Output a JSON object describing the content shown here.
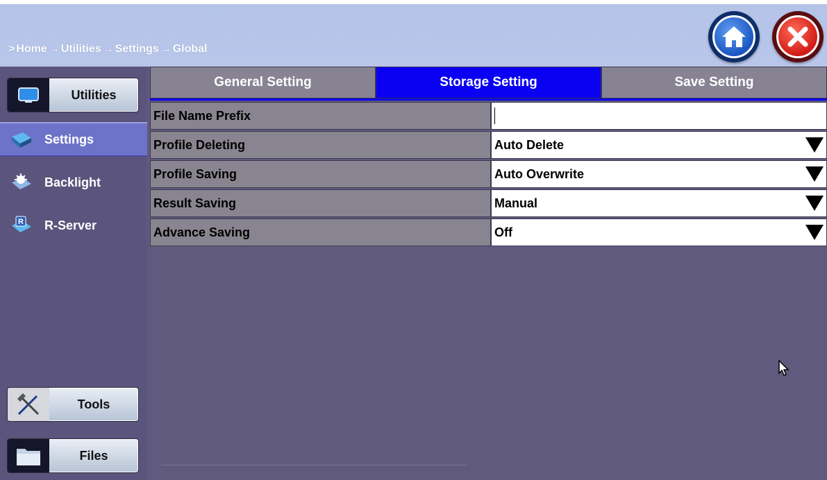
{
  "breadcrumb": [
    "Home",
    "Utilities",
    "Settings",
    "Global"
  ],
  "header": {
    "home_icon": "home-icon",
    "close_icon": "close-icon"
  },
  "sidebar": {
    "top_button": {
      "label": "Utilities",
      "icon": "monitor-icon"
    },
    "items": [
      {
        "label": "Settings",
        "icon": "settings-icon",
        "active": true
      },
      {
        "label": "Backlight",
        "icon": "backlight-icon",
        "active": false
      },
      {
        "label": "R-Server",
        "icon": "r-server-icon",
        "active": false
      }
    ],
    "bottom_buttons": [
      {
        "label": "Tools",
        "icon": "tools-icon"
      },
      {
        "label": "Files",
        "icon": "files-icon"
      }
    ]
  },
  "tabs": [
    {
      "label": "General Setting",
      "active": false
    },
    {
      "label": "Storage Setting",
      "active": true
    },
    {
      "label": "Save Setting",
      "active": false
    }
  ],
  "settings": [
    {
      "label": "File Name Prefix",
      "value": "",
      "type": "text"
    },
    {
      "label": "Profile Deleting",
      "value": "Auto Delete",
      "type": "select"
    },
    {
      "label": "Profile Saving",
      "value": "Auto Overwrite",
      "type": "select"
    },
    {
      "label": "Result Saving",
      "value": "Manual",
      "type": "select"
    },
    {
      "label": "Advance Saving",
      "value": "Off",
      "type": "select"
    }
  ],
  "colors": {
    "header_bg": "#b9c6ea",
    "sidebar_bg": "#5b547c",
    "main_bg": "#605a7e",
    "active_tab": "#0a00f2",
    "active_sidebar_item": "#6d73c8"
  }
}
